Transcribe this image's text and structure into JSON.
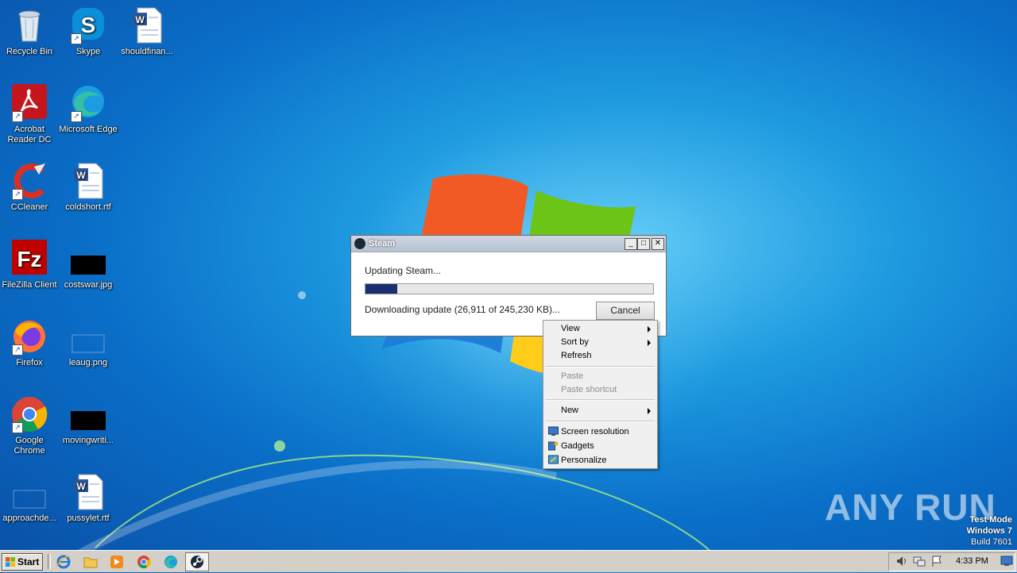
{
  "desktop": {
    "icons": [
      {
        "label": "Recycle Bin"
      },
      {
        "label": "Skype"
      },
      {
        "label": "shouldfinan..."
      },
      {
        "label": "Acrobat Reader DC"
      },
      {
        "label": "Microsoft Edge"
      },
      {
        "label": "CCleaner"
      },
      {
        "label": "coldshort.rtf"
      },
      {
        "label": "FileZilla Client"
      },
      {
        "label": "costswar.jpg"
      },
      {
        "label": "Firefox"
      },
      {
        "label": "leaug.png"
      },
      {
        "label": "Google Chrome"
      },
      {
        "label": "movingwriti..."
      },
      {
        "label": "approachde..."
      },
      {
        "label": "pussylet.rtf"
      }
    ]
  },
  "steam_dialog": {
    "title": "Steam",
    "status": "Updating Steam...",
    "progress_fraction": 0.11,
    "download_text": "Downloading update (26,911 of 245,230 KB)...",
    "cancel_label": "Cancel"
  },
  "context_menu": {
    "items": [
      {
        "label": "View",
        "submenu": true,
        "enabled": true
      },
      {
        "label": "Sort by",
        "submenu": true,
        "enabled": true
      },
      {
        "label": "Refresh",
        "submenu": false,
        "enabled": true
      },
      {
        "label": "Paste",
        "submenu": false,
        "enabled": false
      },
      {
        "label": "Paste shortcut",
        "submenu": false,
        "enabled": false
      },
      {
        "label": "New",
        "submenu": true,
        "enabled": true
      },
      {
        "label": "Screen resolution",
        "icon": "screen-resolution-icon",
        "enabled": true
      },
      {
        "label": "Gadgets",
        "icon": "gadgets-icon",
        "enabled": true
      },
      {
        "label": "Personalize",
        "icon": "personalize-icon",
        "enabled": true
      }
    ]
  },
  "watermark": {
    "text": "ANY RUN",
    "test_mode": "Test Mode",
    "os": "Windows 7",
    "build": "Build 7601"
  },
  "taskbar": {
    "start_label": "Start",
    "pinned": [
      "internet-explorer-icon",
      "file-explorer-icon",
      "media-player-icon",
      "chrome-icon",
      "edge-icon",
      "steam-icon"
    ],
    "time": "4:33 PM"
  }
}
